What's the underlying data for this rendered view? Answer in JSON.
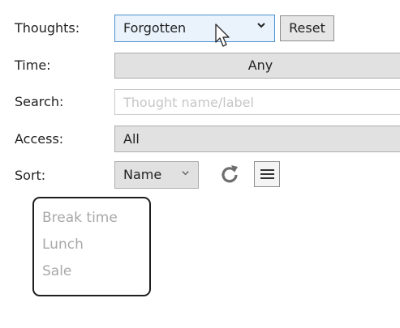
{
  "filters": {
    "thoughts_label": "Thoughts:",
    "thoughts_value": "Forgotten",
    "reset_label": "Reset",
    "time_label": "Time:",
    "time_value": "Any",
    "search_label": "Search:",
    "search_placeholder": "Thought name/label",
    "access_label": "Access:",
    "access_value": "All",
    "sort_label": "Sort:",
    "sort_value": "Name"
  },
  "list": {
    "items": [
      {
        "label": "Break time"
      },
      {
        "label": "Lunch"
      },
      {
        "label": "Sale"
      }
    ]
  },
  "icons": {
    "dropdown": "chevron-down-icon",
    "refresh": "refresh-icon",
    "menu": "hamburger-menu-icon",
    "cursor": "mouse-pointer-icon"
  },
  "colors": {
    "selected_dropdown_border": "#4a8fd1",
    "selected_dropdown_bg": "#eaf3fc",
    "control_bg": "#e1e1e1",
    "list_item_text": "#a8a8a8"
  }
}
